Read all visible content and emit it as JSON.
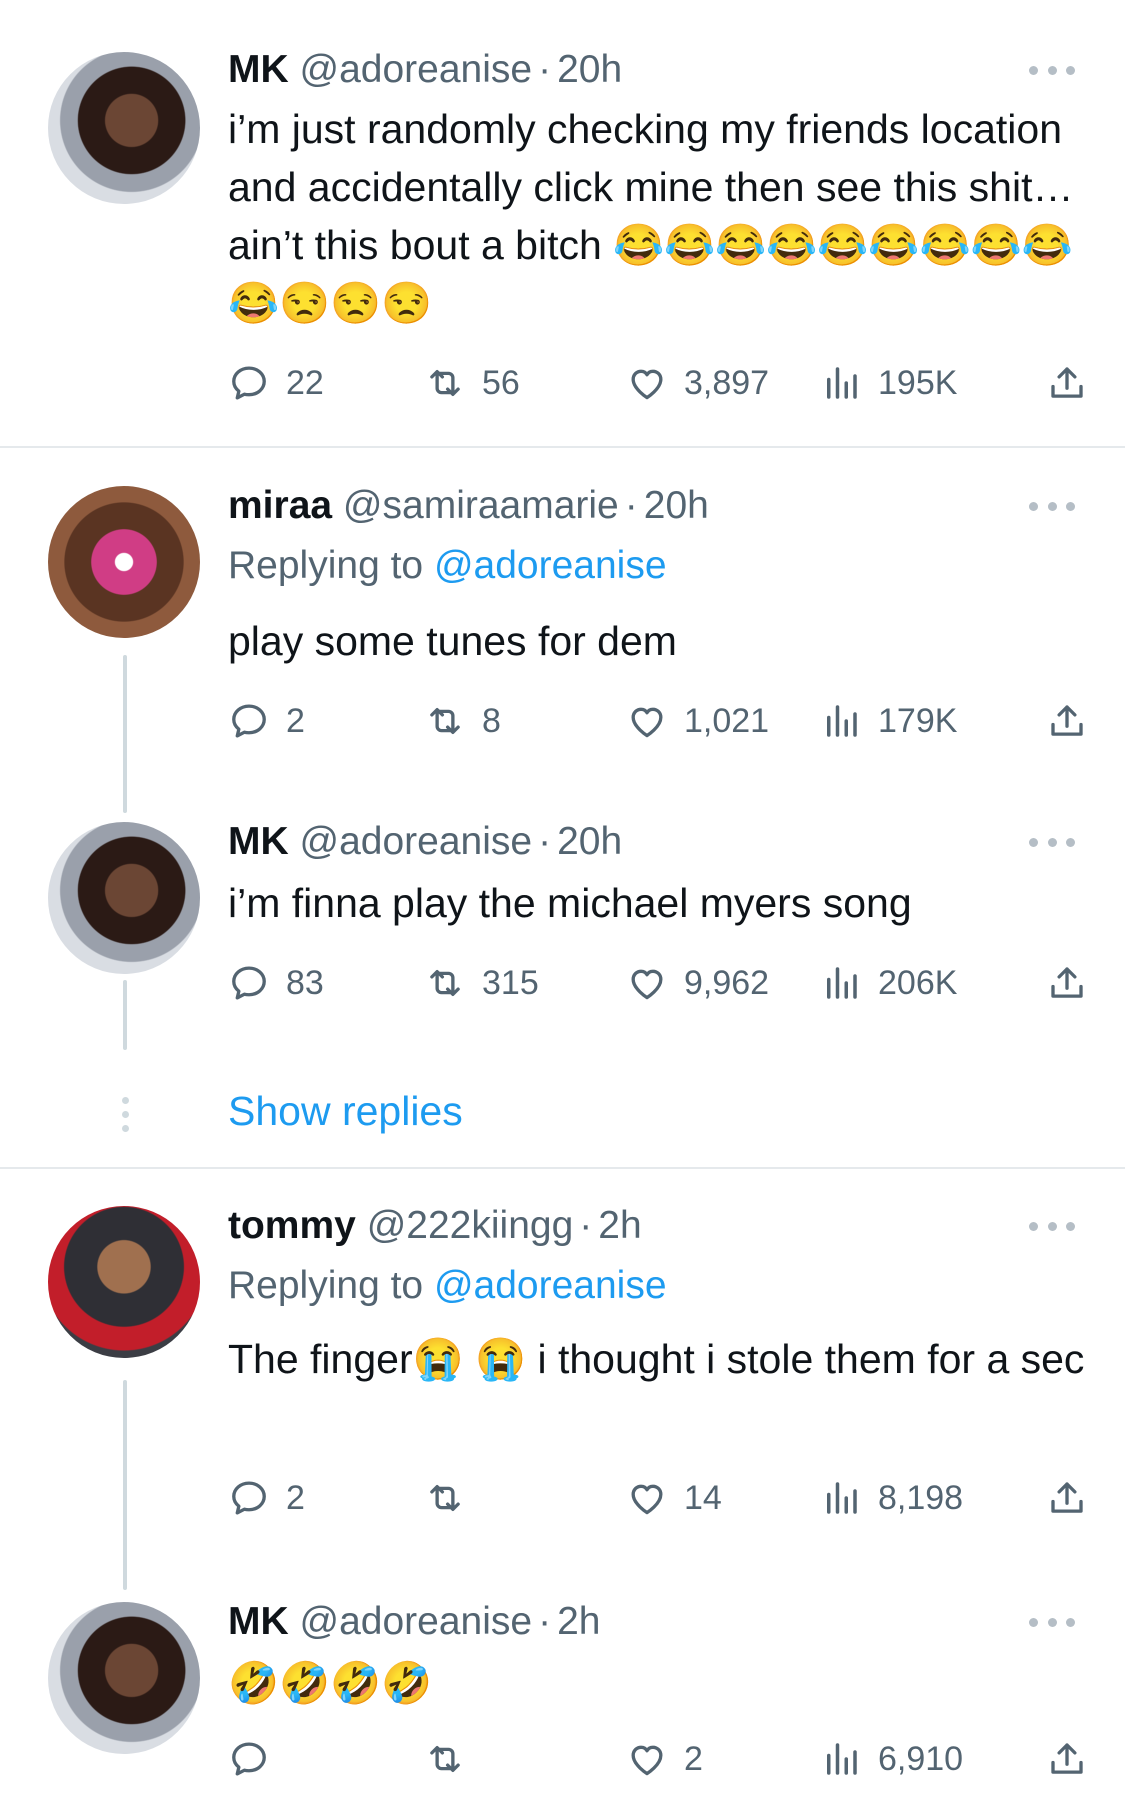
{
  "tweets": [
    {
      "name": "MK",
      "handle": "@adoreanise",
      "dot": "·",
      "time": "20h",
      "replying_label": "",
      "replying_to": "",
      "text": "i’m just randomly checking my friends location and accidentally click mine then see this shit… ain’t this bout a bitch 😂😂😂😂😂😂😂😂😂😂😒😒😒",
      "replies": "22",
      "retweets": "56",
      "likes": "3,897",
      "views": "195K"
    },
    {
      "name": "miraa",
      "handle": "@samiraamarie",
      "dot": "·",
      "time": "20h",
      "replying_label": "Replying to ",
      "replying_to": "@adoreanise",
      "text": "play some tunes for dem",
      "replies": "2",
      "retweets": "8",
      "likes": "1,021",
      "views": "179K"
    },
    {
      "name": "MK",
      "handle": "@adoreanise",
      "dot": "·",
      "time": "20h",
      "replying_label": "",
      "replying_to": "",
      "text": "i’m finna play the michael myers song",
      "replies": "83",
      "retweets": "315",
      "likes": "9,962",
      "views": "206K"
    },
    {
      "name": "tommy",
      "handle": "@222kiingg",
      "dot": "·",
      "time": "2h",
      "replying_label": "Replying to ",
      "replying_to": "@adoreanise",
      "text": "The finger😭 😭 i thought i stole them for a sec",
      "replies": "2",
      "retweets": "",
      "likes": "14",
      "views": "8,198"
    },
    {
      "name": "MK",
      "handle": "@adoreanise",
      "dot": "·",
      "time": "2h",
      "replying_label": "",
      "replying_to": "",
      "text": "🤣🤣🤣🤣",
      "replies": "",
      "retweets": "",
      "likes": "2",
      "views": "6,910"
    }
  ],
  "show_replies": "Show replies",
  "colors": {
    "accent": "#1d9bf0",
    "secondary_text": "#536471",
    "divider": "#e5e9ec",
    "thread_line": "#cfd9de"
  },
  "icons": [
    "reply-icon",
    "retweet-icon",
    "like-icon",
    "views-icon",
    "share-icon",
    "more-icon"
  ]
}
